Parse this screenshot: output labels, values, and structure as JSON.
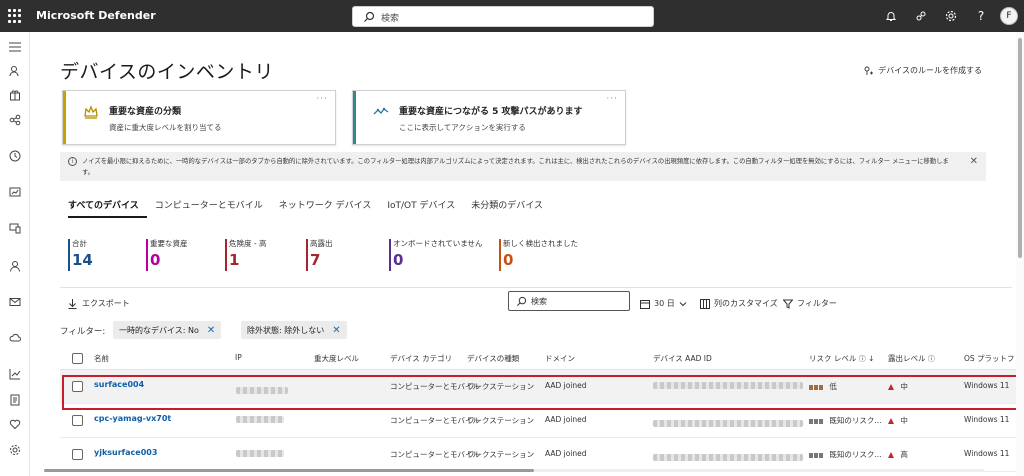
{
  "app": {
    "title": "Microsoft Defender",
    "search_placeholder": "検索",
    "avatar_initial": "F"
  },
  "colors": {
    "topbar": "#2f2f2f",
    "critical_accent": "#c8a100",
    "attack_accent": "#2a8c8c",
    "link": "#0f5fa8",
    "highlight": "#c81e2b"
  },
  "page": {
    "title": "デバイスのインベントリ",
    "create_rule": "デバイスのルールを作成する"
  },
  "cards": [
    {
      "title": "重要な資産の分類",
      "subtitle": "資産に重大度レベルを割り当てる",
      "icon": "crown-icon"
    },
    {
      "title": "重要な資産につながる 5 攻撃パスがあります",
      "subtitle": "ここに表示してアクションを実行する",
      "icon": "attack-path-icon"
    }
  ],
  "notice": {
    "text": "ノイズを最小限に抑えるために、一時的なデバイスは一部のタブから自動的に除外されています。このフィルター処理は内部アルゴリズムによって決定されます。これは主に、検出されたこれらのデバイスの出現頻度に依存します。この自動フィルター処理を無効にするには、フィルター メニューに移動しま す。"
  },
  "tabs": [
    "すべてのデバイス",
    "コンピューターとモバイル",
    "ネットワーク デバイス",
    "IoT/OT デバイス",
    "未分類のデバイス"
  ],
  "stats": [
    {
      "label": "合計",
      "value": "14",
      "color": "#1b4f8a"
    },
    {
      "label": "重要な資産",
      "value": "0",
      "color": "#b4009e"
    },
    {
      "label": "危険度 - 高",
      "value": "1",
      "color": "#a4262c"
    },
    {
      "label": "高露出",
      "value": "7",
      "color": "#a4262c"
    },
    {
      "label": "オンボードされていません",
      "value": "0",
      "color": "#5c2e91"
    },
    {
      "label": "新しく検出されました",
      "value": "0",
      "color": "#ca5010"
    }
  ],
  "toolbar": {
    "export": "エクスポート",
    "search_placeholder": "検索",
    "days": "30 日",
    "customize": "列のカスタマイズ",
    "filter": "フィルター"
  },
  "filters": {
    "label": "フィルター:",
    "chips": [
      "一時的なデバイス: No",
      "除外状態: 除外しない"
    ]
  },
  "table": {
    "headers": [
      "名前",
      "IP",
      "重大度レベル",
      "デバイス カテゴリ",
      "デバイスの種類",
      "ドメイン",
      "デバイス AAD ID",
      "リスク レベル",
      "露出レベル",
      "OS プラットフォーム"
    ],
    "rows": [
      {
        "name": "surface004",
        "category": "コンピューターとモバイル",
        "type": "ワークステーション",
        "domain": "AAD joined",
        "risk": "低",
        "exposure": "中",
        "os": "Windows 11"
      },
      {
        "name": "cpc-yamag-vx70t",
        "category": "コンピューターとモバイル",
        "type": "ワークステーション",
        "domain": "AAD joined",
        "risk": "既知のリスク...",
        "exposure": "中",
        "os": "Windows 11"
      },
      {
        "name": "yjksurface003",
        "category": "コンピューターとモバイル",
        "type": "ワークステーション",
        "domain": "AAD joined",
        "risk": "既知のリスク...",
        "exposure": "高",
        "os": "Windows 11"
      }
    ]
  }
}
